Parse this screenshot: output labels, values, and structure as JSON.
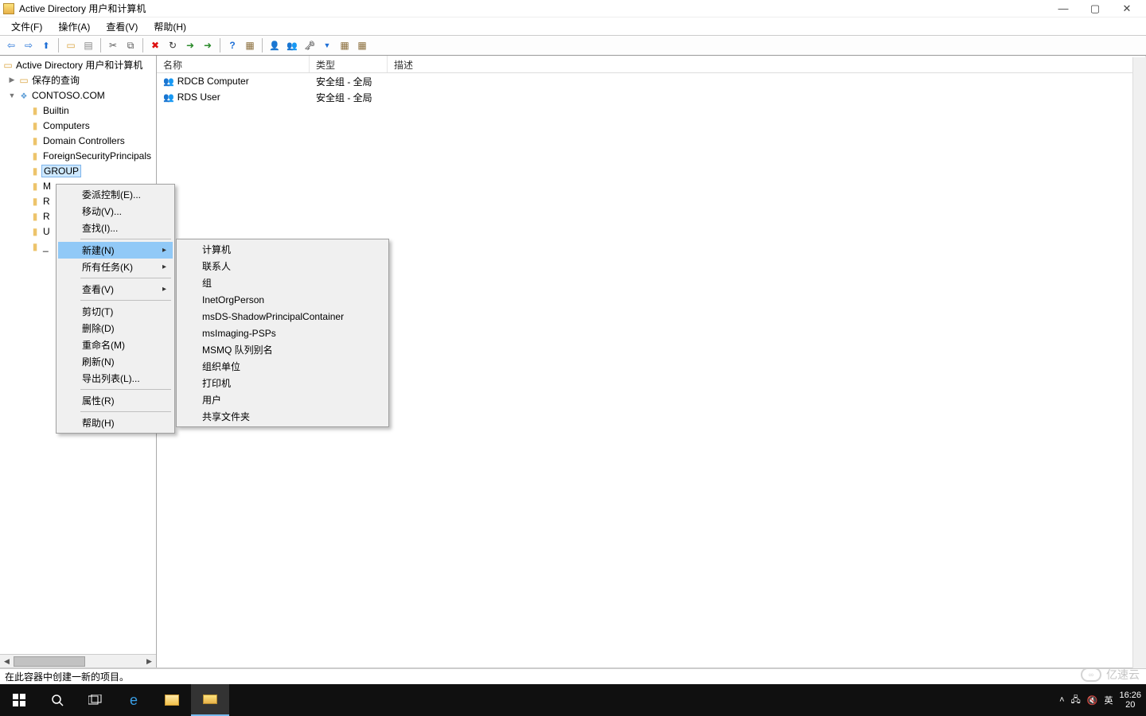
{
  "window": {
    "title": "Active Directory 用户和计算机",
    "min_label": "—",
    "max_label": "▢",
    "close_label": "✕"
  },
  "menu": {
    "file": "文件(F)",
    "action": "操作(A)",
    "view": "查看(V)",
    "help": "帮助(H)"
  },
  "tree": {
    "root": "Active Directory 用户和计算机",
    "saved_queries": "保存的查询",
    "domain": "CONTOSO.COM",
    "nodes": [
      "Builtin",
      "Computers",
      "Domain Controllers",
      "ForeignSecurityPrincipals",
      "GROUP",
      "M",
      "R",
      "R",
      "U"
    ],
    "extra_node": "_"
  },
  "columns": {
    "name": "名称",
    "type": "类型",
    "desc": "描述"
  },
  "list": {
    "rows": [
      {
        "name": "RDCB Computer",
        "type": "安全组 - 全局",
        "desc": ""
      },
      {
        "name": "RDS User",
        "type": "安全组 - 全局",
        "desc": ""
      }
    ]
  },
  "context_main": {
    "delegate": "委派控制(E)...",
    "move": "移动(V)...",
    "find": "查找(I)...",
    "new": "新建(N)",
    "all_tasks": "所有任务(K)",
    "view": "查看(V)",
    "cut": "剪切(T)",
    "delete": "删除(D)",
    "rename": "重命名(M)",
    "refresh": "刷新(N)",
    "export": "导出列表(L)...",
    "properties": "属性(R)",
    "help": "帮助(H)"
  },
  "context_sub": {
    "computer": "计算机",
    "contact": "联系人",
    "group": "组",
    "inetorg": "InetOrgPerson",
    "msds": "msDS-ShadowPrincipalContainer",
    "msimg": "msImaging-PSPs",
    "msmq": "MSMQ 队列别名",
    "ou": "组织单位",
    "printer": "打印机",
    "user": "用户",
    "share": "共享文件夹"
  },
  "statusbar": {
    "text": "在此容器中创建一新的项目。"
  },
  "taskbar": {
    "ime": "英",
    "date_partial": "20",
    "time": "16:26"
  },
  "tray_icons": {
    "up": "˄",
    "net": "🖧",
    "vol": "🔇"
  },
  "watermark": {
    "text": "亿速云"
  }
}
